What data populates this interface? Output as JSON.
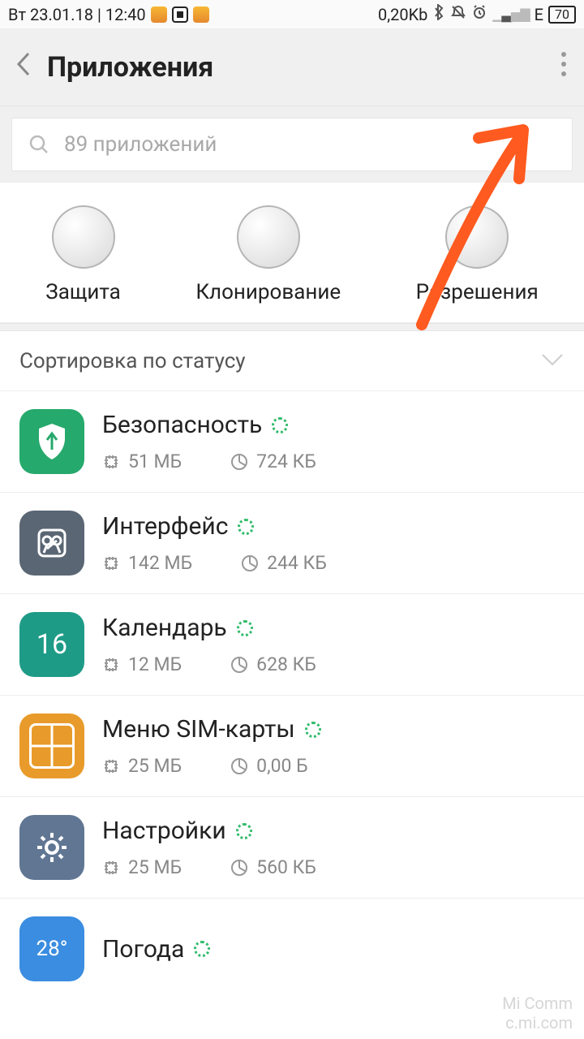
{
  "statusbar": {
    "left_text": "Вт 23.01.18 | 12:40",
    "data_rate": "0,20Kb",
    "network": "E",
    "battery": "70"
  },
  "header": {
    "title": "Приложения"
  },
  "search": {
    "placeholder": "89 приложений"
  },
  "actions": [
    {
      "label": "Защита"
    },
    {
      "label": "Клонирование"
    },
    {
      "label": "Разрешения"
    }
  ],
  "sort": {
    "label": "Сортировка по статусу"
  },
  "apps": [
    {
      "name": "Безопасность",
      "storage": "51 МБ",
      "data": "724 КБ",
      "icon": "security"
    },
    {
      "name": "Интерфейс",
      "storage": "142 МБ",
      "data": "244 КБ",
      "icon": "interface"
    },
    {
      "name": "Календарь",
      "storage": "12 МБ",
      "data": "628 КБ",
      "icon": "calendar",
      "icon_text": "16"
    },
    {
      "name": "Меню SIM-карты",
      "storage": "25 МБ",
      "data": "0,00 Б",
      "icon": "sim"
    },
    {
      "name": "Настройки",
      "storage": "25 МБ",
      "data": "560 КБ",
      "icon": "settings"
    },
    {
      "name": "Погода",
      "storage": "",
      "data": "",
      "icon": "weather",
      "icon_text": "28°"
    }
  ],
  "watermark": {
    "l1": "Mi Comm",
    "l2": "c.mi.com"
  }
}
